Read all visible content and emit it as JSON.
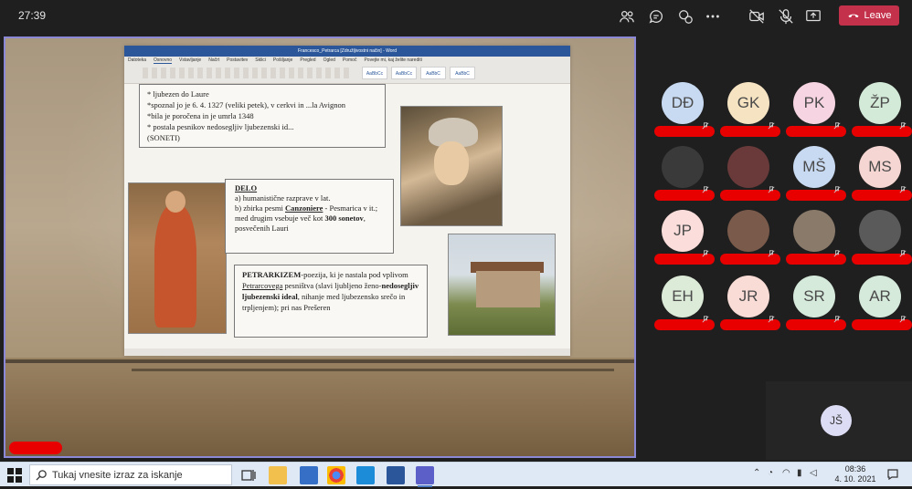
{
  "meeting": {
    "timer": "27:39",
    "leave_label": "Leave"
  },
  "slide": {
    "window_title": "Francesco_Petrarca [Združljivostni način] - Word",
    "ribbon_tabs": [
      "Datoteka",
      "Osnovno",
      "Vstavljanje",
      "Načrt",
      "Postavitev",
      "Sklici",
      "Pošiljanje",
      "Pregled",
      "Ogled",
      "Pomoč",
      "Povejte mi, kaj želite narediti"
    ],
    "ribbon_styles": [
      "AaBbCc",
      "AaBbCc",
      "AaBbC",
      "AaBbC"
    ],
    "box1_lines": [
      "* ljubezen do Laure",
      "*spoznal jo je 6. 4. 1327 (veliki petek), v cerkvi in ...la Avignon",
      "*bila je poročena in je umrla 1348",
      "* postala pesnikov nedosegljiv ljubezenski id...",
      "(SONETI)"
    ],
    "box2": {
      "heading": "DELO",
      "line_a": "a) humanistične razprave v lat.",
      "line_b_pre": "b) zbirka pesmi ",
      "line_b_name": "Canzoniere",
      "line_b_post": " - Pesmarica v it.; med drugim vsebuje več kot ",
      "line_b_bold": "300 sonetov",
      "line_b_end": ", posvečenih Lauri"
    },
    "box3": {
      "head": "PETRARKIZEM",
      "t1": "-poezija, ki je nastala pod vplivom ",
      "name": "Petrarcovega",
      "t2": " pesništva (slavi ljubljeno ženo-",
      "bold": "nedosegljiv ljubezenski ideal",
      "t3": ", nihanje med ljubezensko srečo in trpljenjem); pri nas Prešeren"
    }
  },
  "participants": [
    {
      "initials": "DĐ",
      "color": "#c8daf2"
    },
    {
      "initials": "GK",
      "color": "#f5e3c2"
    },
    {
      "initials": "PK",
      "color": "#f6d4e1"
    },
    {
      "initials": "ŽP",
      "color": "#d4ead8"
    },
    {
      "initials": "",
      "color": "#3a3a3a"
    },
    {
      "initials": "",
      "color": "#6a3a3a"
    },
    {
      "initials": "MŠ",
      "color": "#c8daf2"
    },
    {
      "initials": "MS",
      "color": "#f6d6d2"
    },
    {
      "initials": "JP",
      "color": "#fbdedb"
    },
    {
      "initials": "",
      "color": "#7a5a4a"
    },
    {
      "initials": "",
      "color": "#8a7a6a"
    },
    {
      "initials": "",
      "color": "#5a5a5a"
    },
    {
      "initials": "EH",
      "color": "#dcead8"
    },
    {
      "initials": "JR",
      "color": "#fadcd6"
    },
    {
      "initials": "SR",
      "color": "#d6eadc"
    },
    {
      "initials": "AR",
      "color": "#d6eadc"
    }
  ],
  "self_view": {
    "initials": "JŠ"
  },
  "taskbar": {
    "search_placeholder": "Tukaj vnesite izraz za iskanje",
    "time": "08:36",
    "date": "4. 10. 2021"
  }
}
